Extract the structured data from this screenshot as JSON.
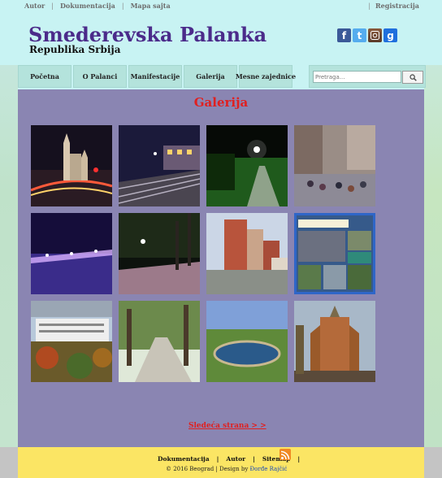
{
  "topbar": {
    "links": [
      "Autor",
      "Dokumentacija",
      "Mapa sajta"
    ],
    "register": "Registracija"
  },
  "header": {
    "title": "Smederevska Palanka",
    "subtitle": "Republika Srbija",
    "social_icons": [
      "facebook-icon",
      "twitter-icon",
      "instagram-icon",
      "google-plus-icon"
    ]
  },
  "nav": {
    "items": [
      "Početna",
      "O Palanci",
      "Manifestacije",
      "Galerija",
      "Mesne zajednice"
    ],
    "search_placeholder": "Pretraga..."
  },
  "main": {
    "heading": "Galerija",
    "next_link": "Sledeća strana > >"
  },
  "footer": {
    "links": [
      "Dokumentacija",
      "Autor",
      "Sitemap"
    ],
    "copyright": "© 2016 Beograd | Design by",
    "author": "Đorđe Rajčić"
  },
  "colors": {
    "title": "#4b2b8a",
    "heading": "#e02020",
    "main_bg": "#8a85b2",
    "header_bg": "#c8f3f3",
    "footer_bg": "#fbe564"
  }
}
